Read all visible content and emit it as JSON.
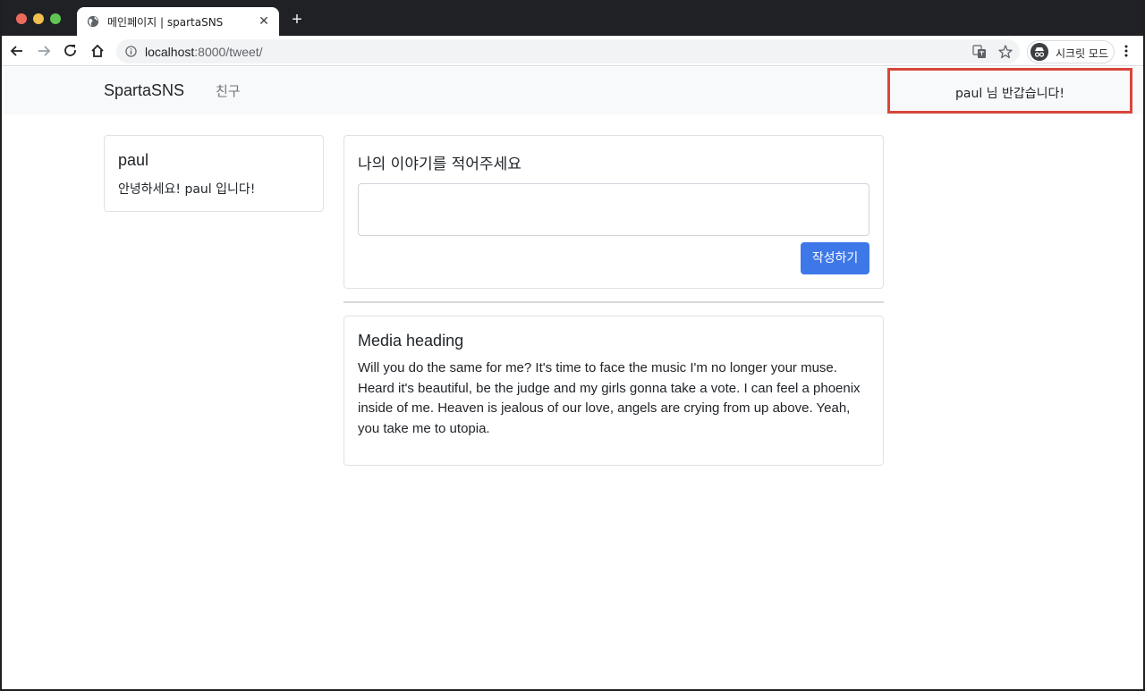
{
  "browser": {
    "tab": {
      "title": "메인페이지 | spartaSNS",
      "close_symbol": "✕",
      "icon": "globe-icon"
    },
    "new_tab_symbol": "+",
    "address": {
      "host": "localhost",
      "path": ":8000/tweet/"
    },
    "incognito_label": "시크릿 모드"
  },
  "navbar": {
    "brand": "SpartaSNS",
    "friends_link": "친구",
    "greeting": "paul 님 반갑습니다!",
    "highlight_color": "#d9463b"
  },
  "profile": {
    "name": "paul",
    "bio": "안녕하세요! paul 입니다!"
  },
  "compose": {
    "title": "나의 이야기를 적어주세요",
    "input_value": "",
    "submit_label": "작성하기",
    "button_color": "#3e78e8"
  },
  "feed": [
    {
      "heading": "Media heading",
      "body": "Will you do the same for me? It's time to face the music I'm no longer your muse. Heard it's beautiful, be the judge and my girls gonna take a vote. I can feel a phoenix inside of me. Heaven is jealous of our love, angels are crying from up above. Yeah, you take me to utopia."
    }
  ]
}
